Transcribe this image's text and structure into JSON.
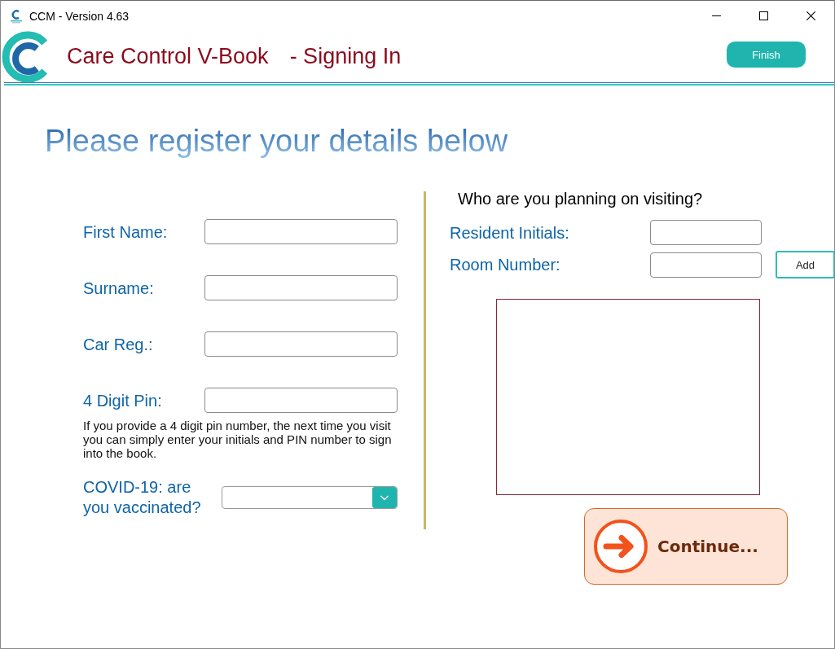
{
  "window": {
    "title": "CCM - Version 4.63"
  },
  "header": {
    "title": "Care Control V-Book",
    "subtitle": "- Signing In",
    "finish_button": "Finish"
  },
  "heading": "Please register your details below",
  "visitor_form": {
    "fields": [
      {
        "label": "First Name:"
      },
      {
        "label": "Surname:"
      },
      {
        "label": "Car Reg.:"
      },
      {
        "label": "4 Digit Pin:"
      }
    ],
    "pin_note": "If you provide a 4 digit pin number, the next time you visit you can simply enter your initials and PIN number to sign into the book.",
    "vaccination": {
      "label": "COVID-19: are you vaccinated?"
    }
  },
  "visit_panel": {
    "question": "Who are you planning on visiting?",
    "fields": [
      {
        "label": "Resident Initials:"
      },
      {
        "label": "Room Number:"
      }
    ],
    "add_button": "Add"
  },
  "continue_button": {
    "label": "Continue..."
  }
}
